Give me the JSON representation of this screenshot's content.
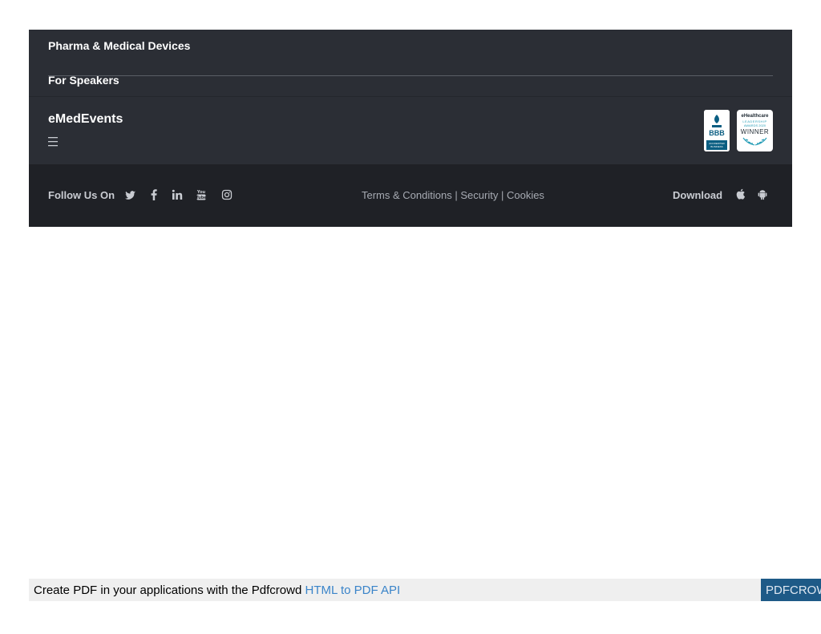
{
  "footer": {
    "nav_items": [
      "Pharma & Medical Devices",
      "For Speakers"
    ],
    "brand": "eMedEvents",
    "menu_icon": "hamburger-icon",
    "badges": {
      "bbb": {
        "top": "BBB",
        "bottom": "ACCREDITED BUSINESS"
      },
      "award": {
        "line1": "eHealthcare",
        "line2": "LEADERSHIP",
        "line3": "AWARDS 2020",
        "line4": "WINNER"
      }
    },
    "follow_label": "Follow Us On",
    "social_icons": [
      "twitter-icon",
      "facebook-icon",
      "linkedin-icon",
      "youtube-icon",
      "instagram-icon"
    ],
    "legal": {
      "terms": "Terms & Conditions",
      "security": "Security",
      "cookies": "Cookies",
      "separator": "|"
    },
    "download_label": "Download",
    "app_icons": [
      "apple-icon",
      "android-icon"
    ]
  },
  "pdf_banner": {
    "text": "Create PDF in your applications with the Pdfcrowd",
    "link": "HTML to PDF API",
    "brand": "PDFCROWD"
  },
  "colors": {
    "footer_bg": "#2b2e35",
    "bottom_bar_bg": "#1f2126",
    "pdf_link": "#3a84c9",
    "pdf_brand_bg": "#1e5a87",
    "bbb_blue": "#0a5e82",
    "award_teal": "#2a9fb8"
  }
}
